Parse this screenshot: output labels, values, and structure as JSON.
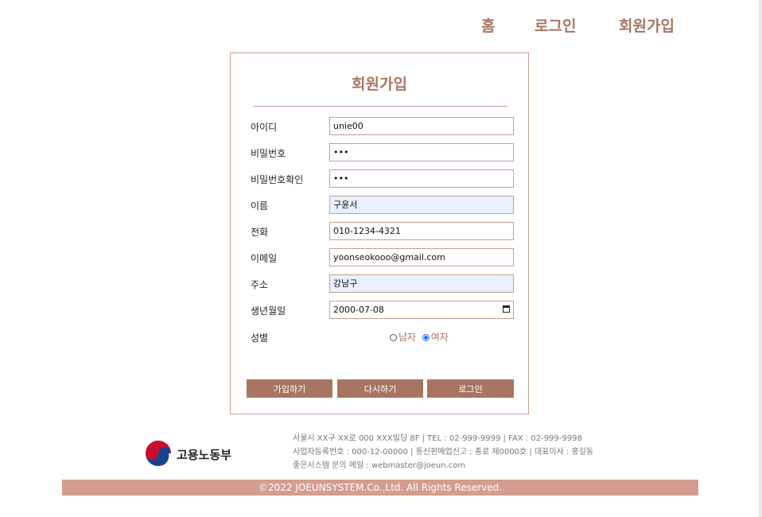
{
  "nav": {
    "home": "홈",
    "login": "로그인",
    "signup": "회원가입"
  },
  "form": {
    "title": "회원가입",
    "fields": [
      {
        "label": "아이디",
        "value": "unie00"
      },
      {
        "label": "비밀번호",
        "value": "•••"
      },
      {
        "label": "비밀번호확인",
        "value": "•••"
      },
      {
        "label": "이름",
        "value": "구윤서"
      },
      {
        "label": "전화",
        "value": "010-1234-4321"
      },
      {
        "label": "이메일",
        "value": "yoonseokooo@gmail.com"
      },
      {
        "label": "주소",
        "value": "강남구"
      },
      {
        "label": "생년월일",
        "value": "2000-07-08"
      }
    ],
    "gender": {
      "label": "성별",
      "male": "남자",
      "female": "여자",
      "selected": "female"
    },
    "buttons": {
      "join": "가입하기",
      "reset": "다시하기",
      "login": "로그인"
    }
  },
  "footer": {
    "logo_text": "고용노동부",
    "logo_icon": "taegeuk-logo-icon",
    "line1": "서울시 XX구 XX로 000 XXX빌딩 8F | TEL : 02-999-9999 | FAX : 02-999-9998",
    "line2": "사업자등록번호 : 000-12-00000 | 통신판매업신고 : 종로 제0000호 | 대표이사 : 홍길동",
    "line3": "좋은시스템 문의 메일 : webmaster@joeun.com",
    "copyright": "©2022 JOEUNSYSTEM.Co.,Ltd. All Rights Reserved."
  },
  "colors": {
    "accent": "#a87563",
    "border": "#c99d8f",
    "footer_bar": "#d39d8f",
    "autofill": "#e8f0fe"
  }
}
